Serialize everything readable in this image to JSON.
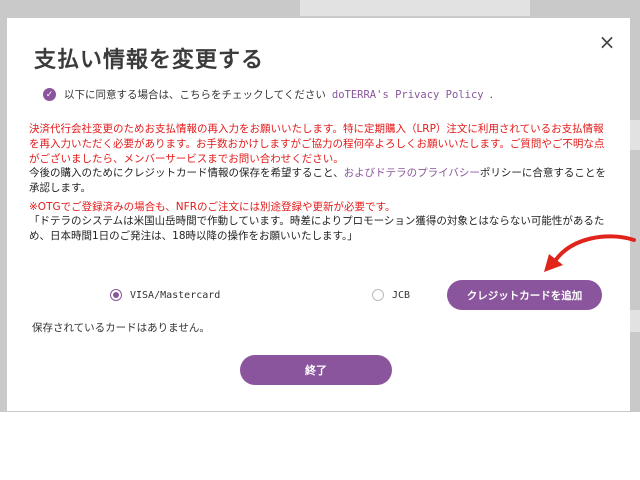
{
  "modal": {
    "title": "支払い情報を変更する",
    "close_symbol": "×",
    "consent_text": "以下に同意する場合は、こちらをチェックしてください",
    "consent_link": "doTERRA's Privacy Policy",
    "consent_dot": ".",
    "notice_red": "決済代行会社変更のためお支払情報の再入力をお願いいたします。特に定期購入（LRP）注文に利用されているお支払情報を再入力いただく必要があります。お手数おかけしますがご協力の程何卒よろしくお願いいたします。ご質問やご不明な点がございましたら、メンバーサービスまでお問い合わせください。",
    "agree_text_1": "今後の購入のためにクレジットカード情報の保存を希望すること、",
    "agree_link": "およびドテラのプライバシー",
    "agree_text_2": "ポリシーに合意することを承認します。",
    "otg_notice": "※OTGでご登録済みの場合も、NFRのご注文には別途登録や更新が必要です。",
    "timezone_notice": "「ドテラのシステムは米国山岳時間で作動しています。時差によりプロモーション獲得の対象とはならない可能性があるため、日本時間1日のご発注は、18時以降の操作をお願いいたします。」",
    "payment_options": [
      {
        "label": "VISA/Mastercard",
        "selected": true
      },
      {
        "label": "JCB",
        "selected": false
      }
    ],
    "add_card_label": "クレジットカードを追加",
    "no_saved_cards": "保存されているカードはありません。",
    "finish_label": "終了"
  },
  "colors": {
    "accent": "#8a559c",
    "warning": "#e31a1a",
    "arrow": "#e0241b"
  }
}
